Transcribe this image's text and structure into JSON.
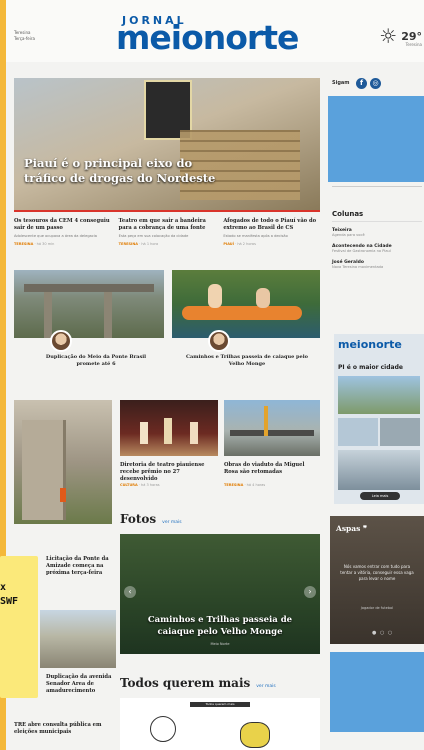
{
  "header": {
    "date_line1": "Teresina",
    "date_line2": "Terça-feira",
    "logo_top": "JORNAL",
    "logo_main": "meionorte",
    "temperature": "29°",
    "weather_loc": "Teresina",
    "weather_icon": "sun-icon"
  },
  "hero": {
    "title": "Piauí é o principal eixo do tráfico de drogas do Nordeste"
  },
  "news_row": [
    {
      "title": "Os tesouros da CEM 4 conseguiu sair de um passo",
      "summary": "Adolescente que ocupava a área da delegacia",
      "tag": "TERESINA",
      "time": "há 30 min"
    },
    {
      "title": "Teatro em que sair a bandeira para a cobrança de uma fonte",
      "summary": "Esta peça em sua colocação da cidade",
      "tag": "TERESINA",
      "time": "há 1 hora"
    },
    {
      "title": "Afogados de todo o Piauí vão do extremo ao Brasil de CS",
      "summary": "Estado se manifesta após a decisão",
      "tag": "PIAUÍ",
      "time": "há 2 horas"
    }
  ],
  "mid_row": [
    {
      "caption": "Duplicação do Meio da Ponte Brasil promete até 6"
    },
    {
      "caption": "Caminhos e Trilhas passeia de caiaque pelo Velho Monge"
    }
  ],
  "small_row": [
    {
      "caption": "Diretoria de teatro piauiense recebe prêmio no 27 desenvolvido",
      "tag": "CULTURA",
      "time": "há 3 horas"
    },
    {
      "caption": "Obras do viaduto da Miguel Rosa são retomadas",
      "tag": "TERESINA",
      "time": "há 4 horas"
    }
  ],
  "sidebar": {
    "sigam": "Sigam",
    "social": [
      "f",
      "◎"
    ],
    "colunas_title": "Colunas",
    "colunas": [
      {
        "name": "Teixeira",
        "desc": "Agenda para você"
      },
      {
        "name": "Acontecendo na Cidade",
        "desc": "Festival de Gastronomia no Piauí"
      },
      {
        "name": "José Geraldo",
        "desc": "Nova Teresina movimentada"
      }
    ],
    "promo_logo": "meionorte",
    "promo_title": "PI é o maior cidade",
    "promo_button": "Leia mais"
  },
  "left_column": {
    "story1_title": "Licitação da Ponte da Amizade começa na próxima terça-feira",
    "story2_title": "Duplicação da avenida Senador Area de amadurecimento",
    "story3_title": "TRE abre consulta pública em eleições municipais"
  },
  "fotos": {
    "title": "Fotos",
    "ver_mais": "ver mais",
    "caption": "Caminhos e Trilhas passeia de caiaque pelo Velho Monge",
    "credit": "Meio Norte"
  },
  "todos": {
    "title": "Todos querem mais",
    "ver_mais": "ver mais",
    "label": "Todos querem mais"
  },
  "aspas": {
    "title": "Aspas",
    "quote": "Nós vamos entrar com tudo para tentar a vitória, conseguir essa vaga para levar o nome",
    "author": "Jogador de futebol",
    "dots": "● ○ ○"
  },
  "sticky_note": {
    "line1": "x",
    "line2": "SWF"
  }
}
